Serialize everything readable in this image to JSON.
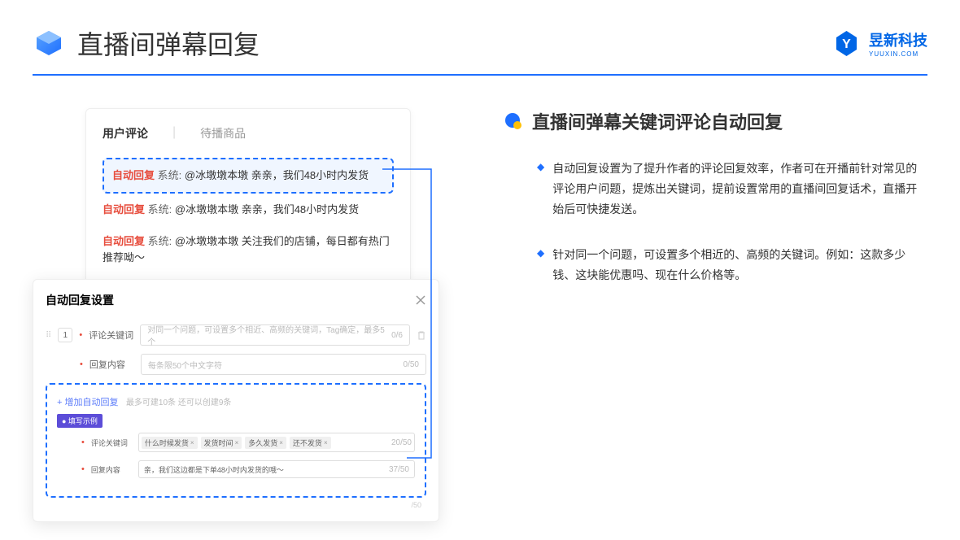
{
  "header": {
    "title": "直播间弹幕回复",
    "logo_cn": "昱新科技",
    "logo_en": "YUUXIN.COM"
  },
  "comments": {
    "tab_active": "用户评论",
    "tab_inactive": "待播商品",
    "divider": "|",
    "auto_badge": "自动回复",
    "sys_label": "系统:",
    "item1": "@冰墩墩本墩 亲亲，我们48小时内发货",
    "item2": "@冰墩墩本墩 亲亲，我们48小时内发货",
    "item3": "@冰墩墩本墩 关注我们的店铺，每日都有热门推荐呦～"
  },
  "settings": {
    "title": "自动回复设置",
    "order": "1",
    "req_dot": "•",
    "label_keyword": "评论关键词",
    "placeholder_keyword": "对同一个问题，可设置多个相近、高频的关键词，Tag确定，最多5个",
    "count_keyword": "0/6",
    "label_content": "回复内容",
    "placeholder_content": "每条限50个中文字符",
    "count_content": "0/50",
    "add_link": "+ 增加自动回复",
    "add_hint": "最多可建10条 还可以创建9条",
    "example_badge": "● 填写示例",
    "example_keyword_label": "评论关键词",
    "tag1": "什么时候发货",
    "tag2": "发货时间",
    "tag3": "多久发货",
    "tag4": "还不发货",
    "count_ex_kw": "20/50",
    "example_content_label": "回复内容",
    "example_content_value": "亲，我们这边都是下单48小时内发货的哦～",
    "count_ex_content": "37/50",
    "extra_count": "/50"
  },
  "right": {
    "section_title": "直播间弹幕关键词评论自动回复",
    "bullet1": "自动回复设置为了提升作者的评论回复效率，作者可在开播前针对常见的评论用户问题，提炼出关键词，提前设置常用的直播间回复话术，直播开始后可快捷发送。",
    "bullet2": "针对同一个问题，可设置多个相近的、高频的关键词。例如：这款多少钱、这块能优惠吗、现在什么价格等。",
    "marker": "◆"
  }
}
